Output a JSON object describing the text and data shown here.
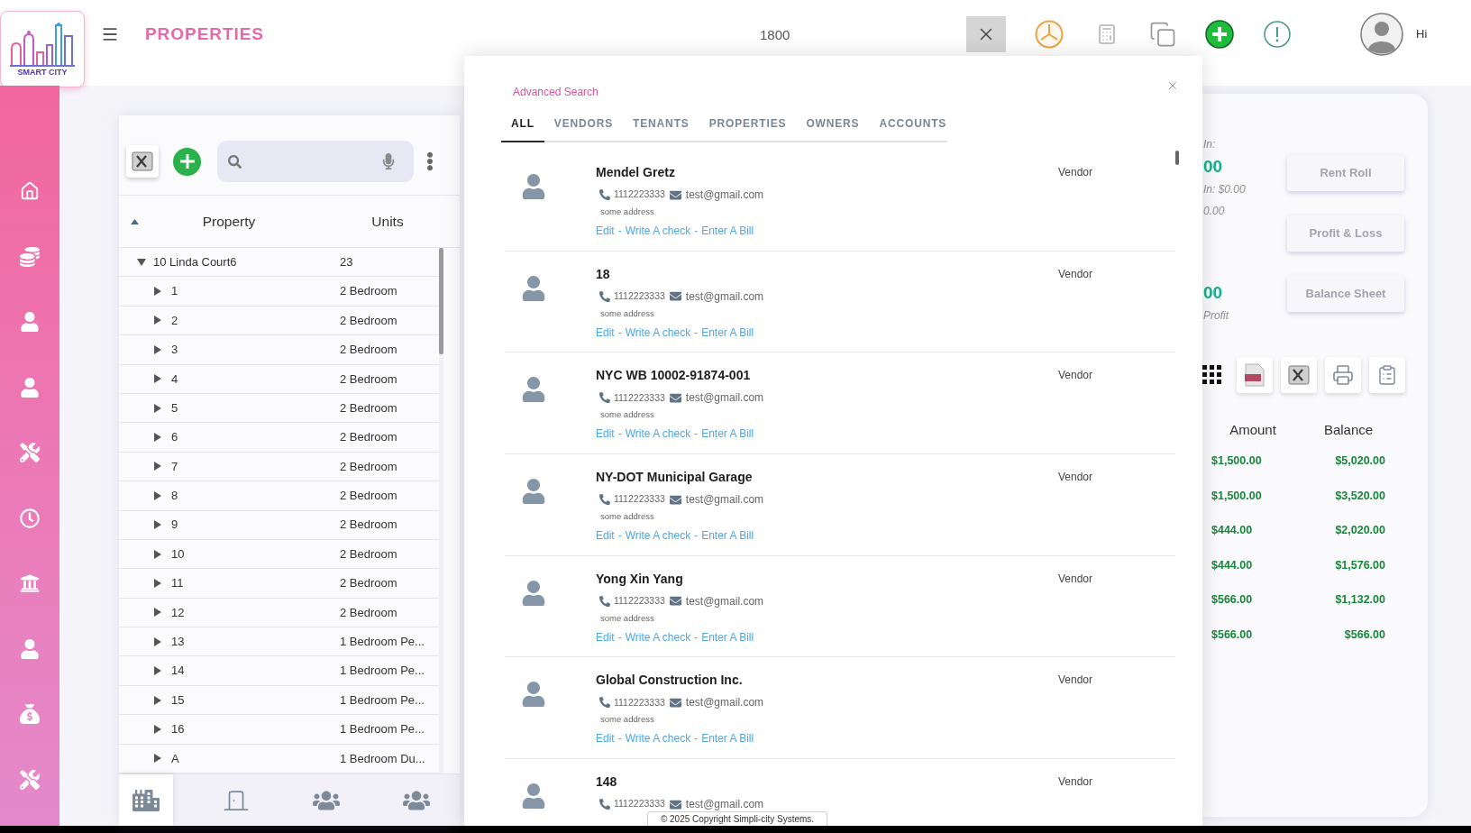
{
  "logo": {
    "text": "SMART CITY"
  },
  "header": {
    "title": "PROPERTIES",
    "search": {
      "value": "1800"
    },
    "greeting": "Hi"
  },
  "property_panel": {
    "columns": [
      "Property",
      "Units"
    ],
    "tree": [
      {
        "name": "10 Linda Court6",
        "units": "23",
        "expanded": true,
        "children": [
          {
            "name": "1",
            "units": "2 Bedroom",
            "expanded": false
          },
          {
            "name": "2",
            "units": "2 Bedroom",
            "expanded": false
          },
          {
            "name": "3",
            "units": "2 Bedroom",
            "expanded": false
          },
          {
            "name": "4",
            "units": "2 Bedroom",
            "expanded": false
          },
          {
            "name": "5",
            "units": "2 Bedroom",
            "expanded": false
          },
          {
            "name": "6",
            "units": "2 Bedroom",
            "expanded": false
          },
          {
            "name": "7",
            "units": "2 Bedroom",
            "expanded": false
          },
          {
            "name": "8",
            "units": "2 Bedroom",
            "expanded": false
          },
          {
            "name": "9",
            "units": "2 Bedroom",
            "expanded": false
          },
          {
            "name": "10",
            "units": "2 Bedroom",
            "expanded": false
          },
          {
            "name": "11",
            "units": "2 Bedroom",
            "expanded": false
          },
          {
            "name": "12",
            "units": "2 Bedroom",
            "expanded": false
          },
          {
            "name": "13",
            "units": "1 Bedroom Pe...",
            "expanded": false
          },
          {
            "name": "14",
            "units": "1 Bedroom Pe...",
            "expanded": false
          },
          {
            "name": "15",
            "units": "1 Bedroom Pe...",
            "expanded": false
          },
          {
            "name": "16",
            "units": "1 Bedroom Pe...",
            "expanded": false
          },
          {
            "name": "A",
            "units": "1 Bedroom Du...",
            "expanded": false
          }
        ]
      }
    ],
    "bottom_tabs": [
      {
        "kind": "buildings",
        "selected": true
      },
      {
        "kind": "door",
        "selected": false
      },
      {
        "kind": "group",
        "selected": false
      },
      {
        "kind": "group",
        "selected": false
      }
    ]
  },
  "advanced_search": {
    "title": "Advanced Search",
    "tabs": [
      {
        "label": "ALL",
        "selected": true
      },
      {
        "label": "VENDORS",
        "selected": false
      },
      {
        "label": "TENANTS",
        "selected": false
      },
      {
        "label": "PROPERTIES",
        "selected": false
      },
      {
        "label": "OWNERS",
        "selected": false
      },
      {
        "label": "ACCOUNTS",
        "selected": false
      }
    ],
    "results": [
      {
        "name": "Mendel Gretz",
        "type": "Vendor",
        "phone": "1112223333",
        "email": "test@gmail.com",
        "address": "some address",
        "actions": [
          "Edit",
          "Write A check",
          "Enter A Bill"
        ],
        "separators": [
          "-",
          "-"
        ]
      },
      {
        "name": "18",
        "type": "Vendor",
        "phone": "1112223333",
        "email": "test@gmail.com",
        "address": "some address",
        "actions": [
          "Edit",
          "Write A check",
          "Enter A Bill"
        ],
        "separators": [
          "-",
          "-"
        ]
      },
      {
        "name": "NYC WB 10002-91874-001",
        "type": "Vendor",
        "phone": "1112223333",
        "email": "test@gmail.com",
        "address": "some address",
        "actions": [
          "Edit",
          "Write A check",
          "Enter A Bill"
        ],
        "separators": [
          "-",
          "-"
        ]
      },
      {
        "name": "NY-DOT Municipal Garage",
        "type": "Vendor",
        "phone": "1112223333",
        "email": "test@gmail.com",
        "address": "some address",
        "actions": [
          "Edit",
          "Write A check",
          "Enter A Bill"
        ],
        "separators": [
          "-",
          "-"
        ]
      },
      {
        "name": "Yong Xin Yang",
        "type": "Vendor",
        "phone": "1112223333",
        "email": "test@gmail.com",
        "address": "some address",
        "actions": [
          "Edit",
          "Write A check",
          "Enter A Bill"
        ],
        "separators": [
          "-",
          "-"
        ]
      },
      {
        "name": "Global Construction Inc.",
        "type": "Vendor",
        "phone": "1112223333",
        "email": "test@gmail.com",
        "address": "some address",
        "actions": [
          "Edit",
          "Write A check",
          "Enter A Bill"
        ],
        "separators": [
          "-",
          "-"
        ]
      },
      {
        "name": "148",
        "type": "Vendor",
        "phone": "1112223333",
        "email": "test@gmail.com"
      }
    ]
  },
  "right_panel": {
    "summary_groups": [
      [
        {
          "kind": "label",
          "text": "In:"
        },
        {
          "kind": "value",
          "text": "00"
        },
        {
          "kind": "label",
          "text": "In: $0.00"
        },
        {
          "kind": "label",
          "text": "0.00"
        }
      ],
      [
        {
          "kind": "value",
          "text": "00"
        },
        {
          "kind": "label",
          "text": "Profit"
        }
      ]
    ],
    "report_buttons": [
      "Rent Roll",
      "Profit & Loss",
      "Balance Sheet"
    ],
    "ledger": {
      "columns": [
        "Amount",
        "Balance"
      ],
      "rows": [
        [
          "$1,500.00",
          "$5,020.00"
        ],
        [
          "$1,500.00",
          "$3,520.00"
        ],
        [
          "$444.00",
          "$2,020.00"
        ],
        [
          "$444.00",
          "$1,576.00"
        ],
        [
          "$566.00",
          "$1,132.00"
        ],
        [
          "$566.00",
          "$566.00"
        ]
      ]
    }
  },
  "footer": {
    "copyright": "© 2025 Copyright Simpli-city Systems."
  }
}
